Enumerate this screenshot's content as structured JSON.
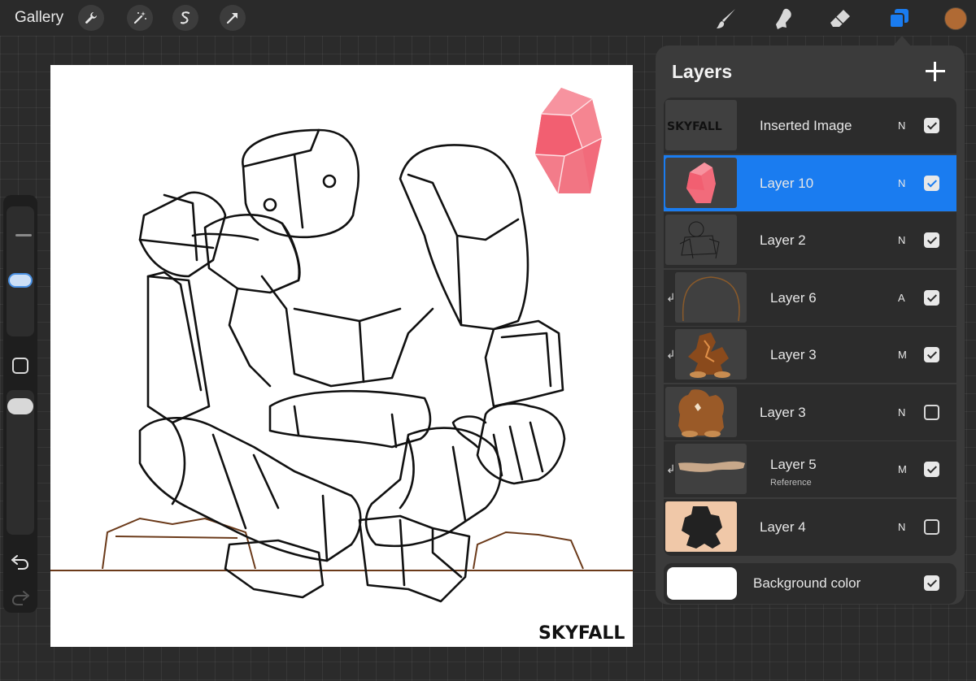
{
  "topbar": {
    "gallery_label": "Gallery",
    "left_tools": [
      "wrench-icon",
      "magic-wand-icon",
      "selection-s-icon",
      "transform-arrow-icon"
    ],
    "right_tools": [
      "brush-icon",
      "smudge-icon",
      "eraser-icon",
      "layers-icon"
    ],
    "current_color": "#b06a34",
    "accent_color": "#1a7cf0"
  },
  "canvas": {
    "signature_text": "SKYFALL"
  },
  "sidebar": {
    "icons": [
      "brush-size-slider",
      "modify-square-icon",
      "opacity-slider",
      "undo-icon",
      "redo-icon"
    ]
  },
  "layers_panel": {
    "title": "Layers",
    "add_icon": "plus-icon",
    "layers": [
      {
        "name": "Inserted Image",
        "blend": "N",
        "visible": true,
        "thumb_text": "SKYFALL"
      },
      {
        "name": "Layer 10",
        "blend": "N",
        "visible": true,
        "selected": true
      },
      {
        "name": "Layer 2",
        "blend": "N",
        "visible": true
      },
      {
        "name": "Layer 6",
        "blend": "A",
        "visible": true,
        "clipped": true
      },
      {
        "name": "Layer 3",
        "blend": "M",
        "visible": true,
        "clipped": true
      },
      {
        "name": "Layer 3",
        "blend": "N",
        "visible": false
      },
      {
        "name": "Layer 5",
        "blend": "M",
        "visible": true,
        "clipped": true,
        "sub": "Reference"
      },
      {
        "name": "Layer 4",
        "blend": "N",
        "visible": false
      }
    ],
    "background_label": "Background color"
  }
}
